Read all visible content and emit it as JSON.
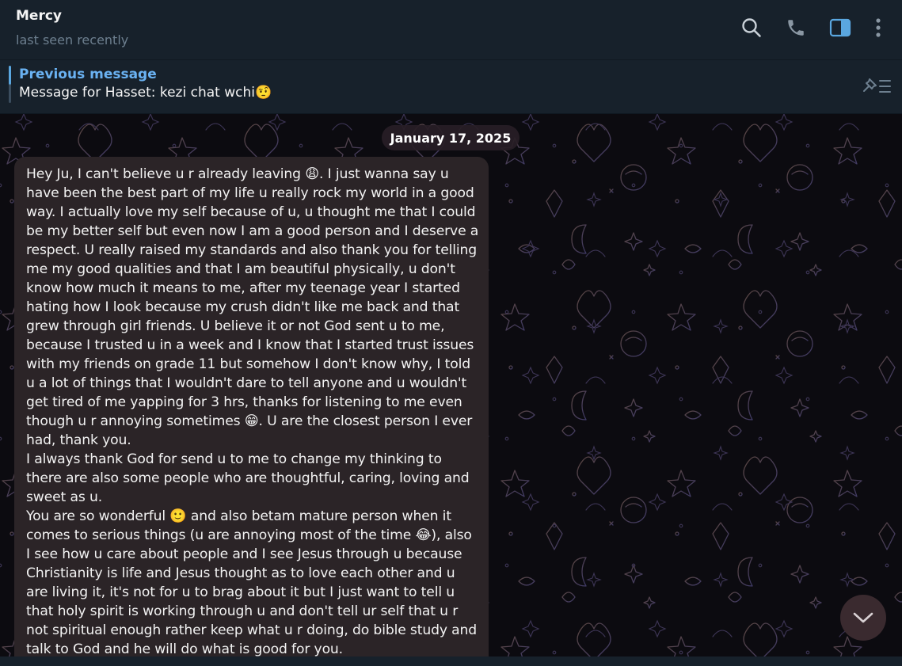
{
  "header": {
    "contact_name": "Mercy",
    "status": "last seen recently",
    "icons": [
      "search-icon",
      "phone-icon",
      "sidebar-toggle-icon",
      "more-vertical-icon"
    ]
  },
  "pinned": {
    "title": "Previous message",
    "text": "Message for Hasset: kezi chat wchi🤨",
    "icon": "pinned-list-icon"
  },
  "chat": {
    "date": "January 17, 2025",
    "message": {
      "paragraphs": [
        "Hey Ju, I can't believe u r already leaving 😩. I just wanna say u have been the best part of my life u really rock my world in a good way. I actually love my self because of u, u thought me that I could be my better self but even now I am a good person and I deserve a respect. U really raised my standards and also thank you for telling me my good qualities and that I am beautiful physically, u don't know how much it means to me, after my teenage year I started hating how I look because my crush didn't like me back and that grew through girl friends. U believe it or not God sent u to me, because I trusted u in a week and I know that I started trust issues with my friends on grade 11 but somehow I don't know why, I told u a lot of things that I wouldn't dare to tell anyone and u wouldn't get tired of me yapping for 3 hrs, thanks for listening to me even though u r annoying sometimes 😁. U are the closest person I ever had, thank you.",
        "I always thank God for send u to me to change my thinking to there are also some people who are thoughtful, caring, loving and sweet as u.",
        "You are so wonderful 🙂 and also betam mature person when it comes to serious things (u are annoying most of the time 😂), also I see how u care about people and I see Jesus through u because Christianity is life and Jesus thought as to love each other and u are living it, it's not for u to brag about it but I just want to tell u that holy spirit is working through u and don't tell ur self that u r not spiritual enough rather keep what u r doing, do bible study and talk to God and he will do what is good for you."
      ]
    },
    "scroll_button_icon": "chevron-down-icon"
  },
  "colors": {
    "header_bg": "#17212b",
    "accent": "#6ab2f2",
    "bubble_bg": "#2b2427",
    "chat_bg": "#0c0b10",
    "muted_text": "#6d7f8f"
  }
}
